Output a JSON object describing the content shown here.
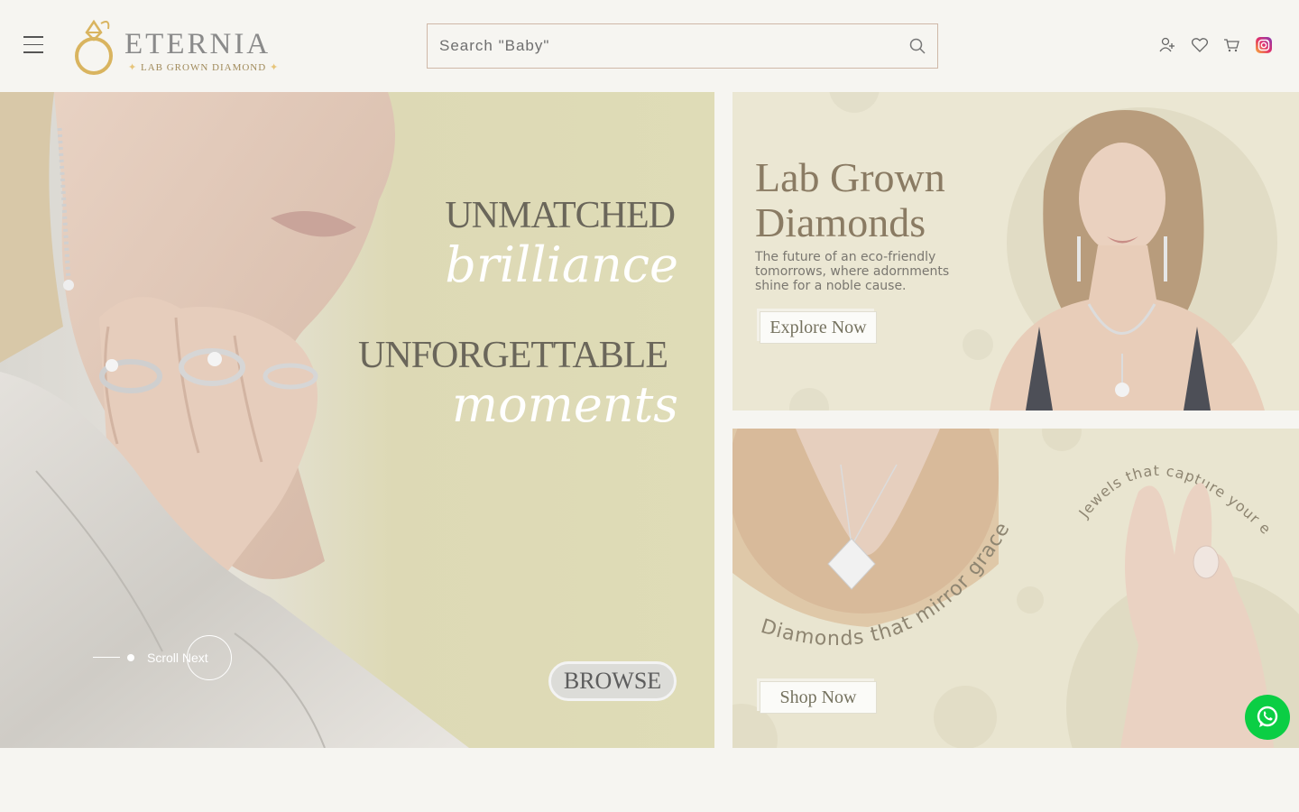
{
  "header": {
    "logo": {
      "name": "ETERNIA",
      "tagline": "LAB GROWN DIAMOND"
    },
    "search": {
      "placeholder": "Search \"Baby\""
    },
    "icons": [
      "account-add-icon",
      "heart-icon",
      "cart-icon",
      "instagram-icon"
    ]
  },
  "hero": {
    "line1": "UNMATCHED",
    "line2": "brilliance",
    "line3": "UNFORGETTABLE",
    "line4": "moments",
    "browse_label": "BROWSE",
    "scroll_label": "Scroll Next"
  },
  "banner1": {
    "title_line1": "Lab Grown",
    "title_line2": "Diamonds",
    "subtitle_line1": "The future of an eco-friendly",
    "subtitle_line2": "tomorrows, where adornments",
    "subtitle_line3": "shine for a noble cause.",
    "button_label": "Explore Now"
  },
  "banner2": {
    "curved_text_1": "Diamonds that mirror grace",
    "curved_text_2": "Jewels that capture your essence",
    "button_label": "Shop Now"
  },
  "colors": {
    "background": "#f6f5f1",
    "accent_gold": "#d9b45f",
    "hero_panel": "#dfdcb7",
    "banner_bg": "#ebe7d3",
    "whatsapp": "#0bce44"
  }
}
